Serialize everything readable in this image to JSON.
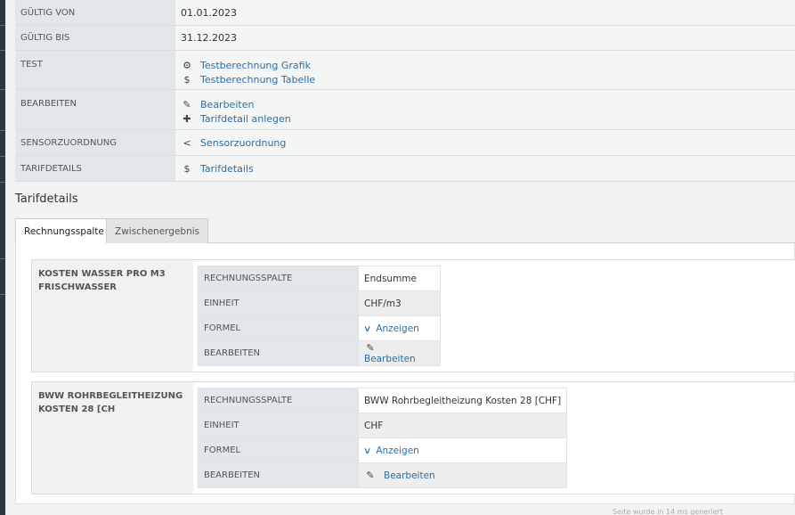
{
  "properties": [
    {
      "label": "GÜLTIG VON",
      "value": "01.01.2023"
    },
    {
      "label": "GÜLTIG BIS",
      "value": "31.12.2023"
    },
    {
      "label": "TEST",
      "links": [
        {
          "icon": "gear-icon",
          "glyph": "⚙",
          "text": "Testberechnung Grafik"
        },
        {
          "icon": "dollar-icon",
          "glyph": "$",
          "text": "Testberechnung Tabelle"
        }
      ]
    },
    {
      "label": "BEARBEITEN",
      "links": [
        {
          "icon": "edit-icon",
          "glyph": "✎",
          "text": "Bearbeiten"
        },
        {
          "icon": "plus-icon",
          "glyph": "✚",
          "text": "Tarifdetail anlegen"
        }
      ]
    },
    {
      "label": "SENSORZUORDNUNG",
      "links": [
        {
          "icon": "share-icon",
          "glyph": "<",
          "text": "Sensorzuordnung"
        }
      ]
    },
    {
      "label": "TARIFDETAILS",
      "links": [
        {
          "icon": "dollar-icon",
          "glyph": "$",
          "text": "Tarifdetails"
        }
      ]
    }
  ],
  "section_title": "Tarifdetails",
  "tabs": [
    {
      "label": "Rechnungsspalte",
      "active": true
    },
    {
      "label": "Zwischenergebnis",
      "active": false
    }
  ],
  "cards": [
    {
      "title": "KOSTEN WASSER PRO M3 FRISCHWASSER",
      "rows": [
        {
          "key": "RECHNUNGSSPALTE",
          "value": "Endsumme"
        },
        {
          "key": "EINHEIT",
          "value": "CHF/m3"
        },
        {
          "key": "FORMEL",
          "link": "Anzeigen",
          "icon": "chevron-down-icon"
        },
        {
          "key": "BEARBEITEN",
          "link": "Bearbeiten",
          "icon": "edit-icon"
        }
      ]
    },
    {
      "title": "BWW ROHRBEGLEITHEIZUNG KOSTEN 28 [CH",
      "rows": [
        {
          "key": "RECHNUNGSSPALTE",
          "value": "BWW Rohrbegleitheizung Kosten 28 [CHF]"
        },
        {
          "key": "EINHEIT",
          "value": "CHF"
        },
        {
          "key": "FORMEL",
          "link": "Anzeigen",
          "icon": "chevron-down-icon"
        },
        {
          "key": "BEARBEITEN",
          "link": "Bearbeiten",
          "icon": "edit-icon"
        }
      ]
    }
  ],
  "footer": "Seite wurde in 14 ms generiert"
}
